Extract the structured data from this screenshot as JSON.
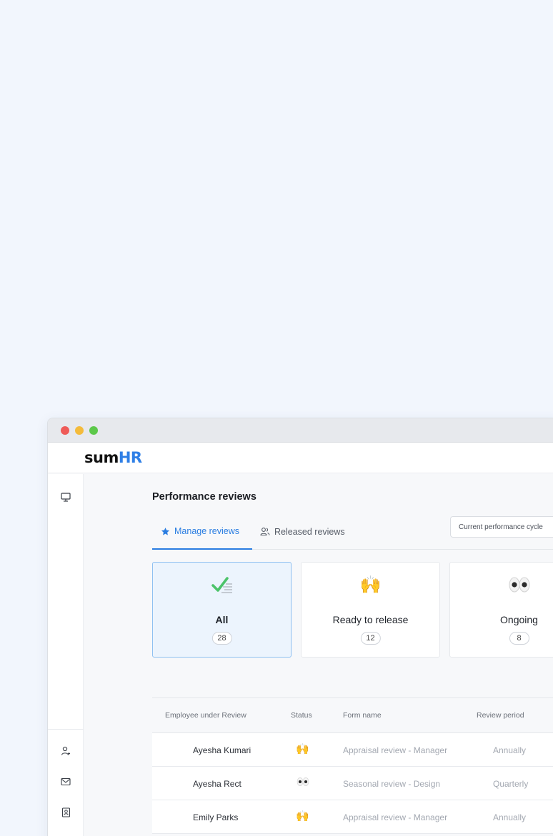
{
  "window": {
    "logo": {
      "sum": "sum",
      "hr": "HR"
    }
  },
  "sidebar": {
    "icons": [
      "monitor-icon",
      "add-user-icon",
      "mail-icon",
      "contact-book-icon"
    ]
  },
  "page": {
    "title": "Performance reviews",
    "tabs": [
      {
        "label": "Manage reviews",
        "icon": "star-icon",
        "active": true
      },
      {
        "label": "Released reviews",
        "icon": "users-icon",
        "active": false
      }
    ],
    "cycle_select": "Current performance cycle"
  },
  "cards": [
    {
      "label": "All",
      "count": "28",
      "emoji": "check-icon",
      "selected": true
    },
    {
      "label": "Ready to release",
      "count": "12",
      "emoji": "🙌",
      "selected": false
    },
    {
      "label": "Ongoing",
      "count": "8",
      "emoji": "eyes-icon",
      "selected": false
    }
  ],
  "table": {
    "headers": [
      "Employee under Review",
      "Status",
      "Form name",
      "Review period"
    ],
    "rows": [
      {
        "name": "Ayesha Kumari",
        "status": "🙌",
        "form": "Appraisal review - Manager",
        "period": "Annually"
      },
      {
        "name": "Ayesha Rect",
        "status": "eyes",
        "form": "Seasonal review - Design",
        "period": "Quarterly"
      },
      {
        "name": "Emily Parks",
        "status": "🙌",
        "form": "Appraisal review - Manager",
        "period": "Annually"
      }
    ]
  },
  "colors": {
    "accent": "#2a7de1",
    "background": "#f2f6fd",
    "selected_card": "#ecf4fd"
  }
}
